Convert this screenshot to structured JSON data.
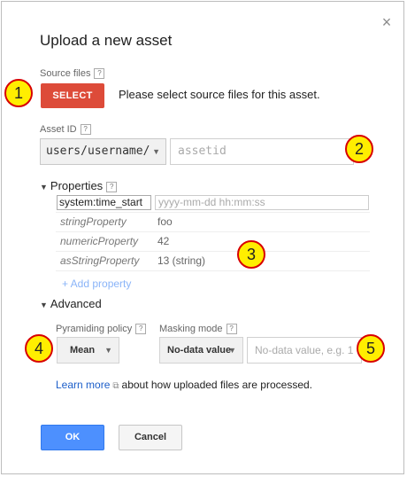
{
  "dialog": {
    "title": "Upload a new asset",
    "close_glyph": "×"
  },
  "source": {
    "label": "Source files",
    "help": "?",
    "button": "SELECT",
    "hint": "Please select source files for this asset."
  },
  "asset_id": {
    "label": "Asset ID",
    "help": "?",
    "prefix": "users/username/",
    "placeholder": "assetid"
  },
  "properties": {
    "heading": "Properties",
    "help": "?",
    "rows": [
      {
        "key": "system:time_start",
        "value": "yyyy-mm-dd hh:mm:ss"
      },
      {
        "key": "stringProperty",
        "value": "foo"
      },
      {
        "key": "numericProperty",
        "value": "42"
      },
      {
        "key": "asStringProperty",
        "value": "13 (string)"
      }
    ],
    "add_label": "+ Add property"
  },
  "advanced": {
    "heading": "Advanced",
    "pyramiding_label": "Pyramiding policy",
    "pyramiding_value": "Mean",
    "masking_label": "Masking mode",
    "masking_value": "No-data value",
    "nodata_placeholder": "No-data value, e.g. 1",
    "help": "?"
  },
  "learn": {
    "link": "Learn more",
    "text": "about how uploaded files are processed."
  },
  "actions": {
    "ok": "OK",
    "cancel": "Cancel"
  },
  "callouts": [
    "1",
    "2",
    "3",
    "4",
    "5"
  ],
  "colors": {
    "select_button": "#dd4b39",
    "ok_button": "#4d90fe",
    "link": "#1c5ec9",
    "callout_fill": "#ffee00",
    "callout_border": "#d80000"
  }
}
